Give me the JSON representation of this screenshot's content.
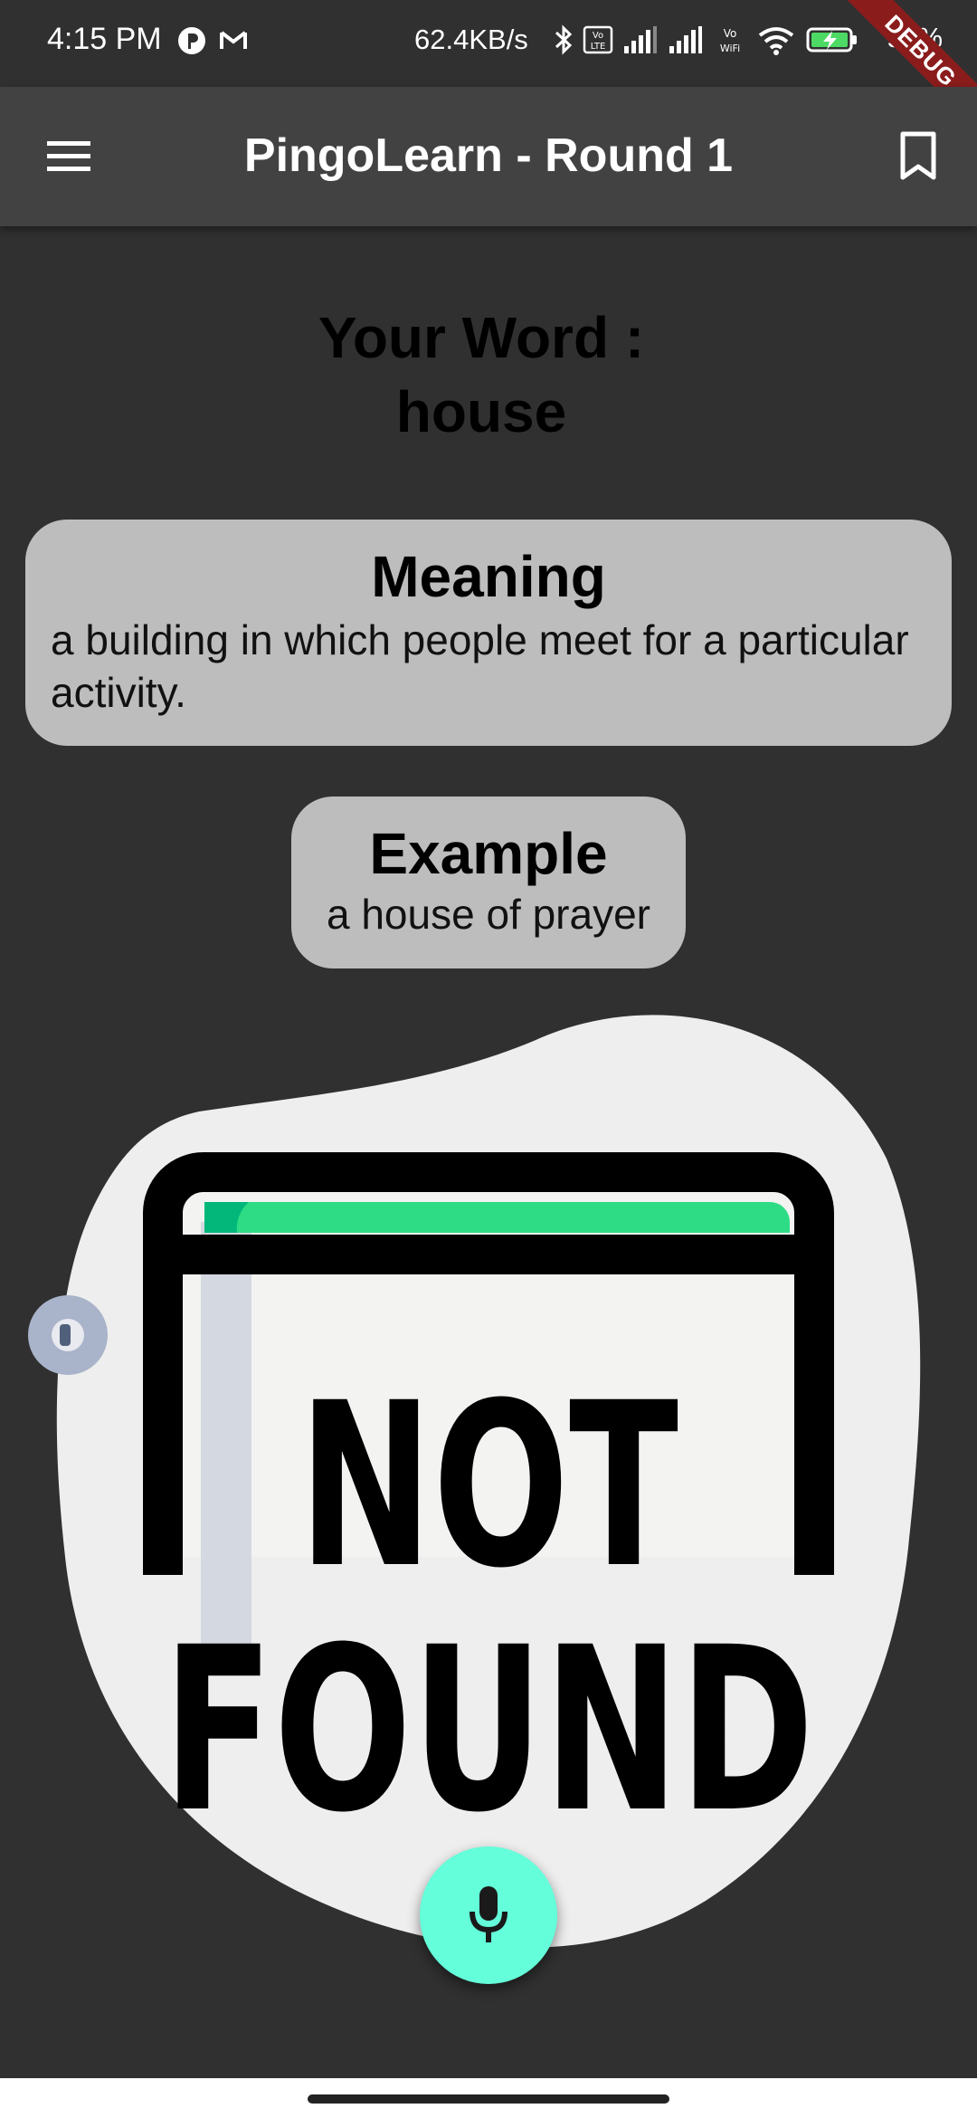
{
  "status_bar": {
    "time": "4:15 PM",
    "network_speed": "62.4KB/s",
    "battery_percent": "96%",
    "icons": [
      "p-app-icon",
      "gmail-icon",
      "bluetooth-icon",
      "volte-icon",
      "signal-icon",
      "signal-icon",
      "vowifi-icon",
      "wifi-icon",
      "battery-charging-icon"
    ]
  },
  "debug_banner": "DEBUG",
  "app_bar": {
    "title": "PingoLearn - Round 1",
    "menu_icon": "hamburger-menu-icon",
    "bookmark_icon": "bookmark-icon"
  },
  "word": {
    "label": "Your Word :",
    "value": "house"
  },
  "meaning": {
    "title": "Meaning",
    "text": "a building in which people meet for a particular activity."
  },
  "example": {
    "title": "Example",
    "text": "a house of prayer"
  },
  "illustration": {
    "line1": "NOT",
    "line2": "FOUND"
  },
  "mic_button": {
    "icon": "microphone-icon",
    "color": "#64ffda"
  },
  "colors": {
    "background": "#303030",
    "app_bar": "#424242",
    "card": "#bdbdbd",
    "accent_green": "#2edc85"
  }
}
